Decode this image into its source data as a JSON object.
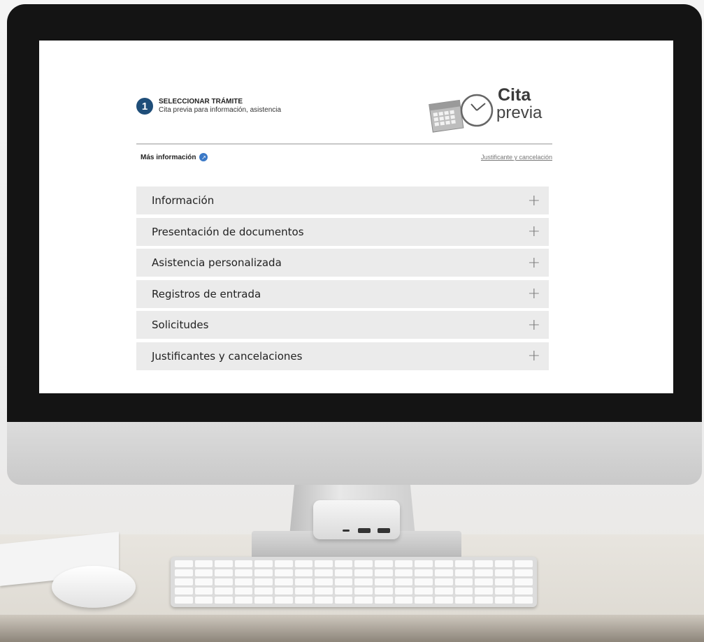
{
  "step": {
    "number": "1",
    "title": "SELECCIONAR TRÁMITE",
    "subtitle": "Cita previa para información, asistencia"
  },
  "logo": {
    "line1": "Cita",
    "line2": "previa"
  },
  "links": {
    "more_info": "Más información",
    "justificante": "Justificante y cancelación"
  },
  "accordion": {
    "items": [
      {
        "label": "Información",
        "icon": "plus-icon"
      },
      {
        "label": "Presentación de documentos",
        "icon": "plus-icon"
      },
      {
        "label": "Asistencia personalizada",
        "icon": "plus-icon"
      },
      {
        "label": "Registros de entrada",
        "icon": "plus-icon"
      },
      {
        "label": "Solicitudes",
        "icon": "plus-icon"
      },
      {
        "label": "Justificantes y cancelaciones",
        "icon": "plus-icon"
      }
    ]
  },
  "colors": {
    "step_circle": "#1f4e79",
    "accordion_bg": "#ebebeb",
    "link_icon": "#3b79c7"
  }
}
